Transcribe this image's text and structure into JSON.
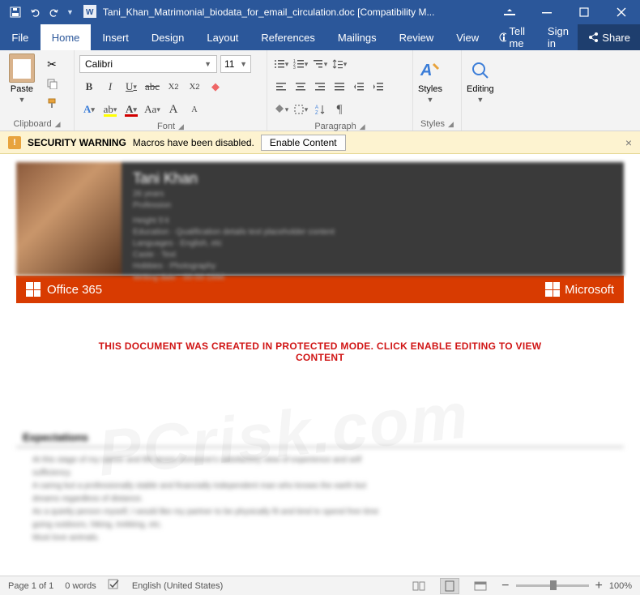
{
  "titlebar": {
    "filename": "Tani_Khan_Matrimonial_biodata_for_email_circulation.doc [Compatibility M..."
  },
  "menubar": {
    "file": "File",
    "tabs": [
      "Home",
      "Insert",
      "Design",
      "Layout",
      "References",
      "Mailings",
      "Review",
      "View"
    ],
    "tell": "Tell me",
    "signin": "Sign in",
    "share": "Share"
  },
  "ribbon": {
    "clipboard": {
      "paste": "Paste",
      "label": "Clipboard"
    },
    "font": {
      "name": "Calibri",
      "size": "11",
      "label": "Font"
    },
    "paragraph": {
      "label": "Paragraph"
    },
    "styles": {
      "btn": "Styles",
      "label": "Styles"
    },
    "editing": {
      "btn": "Editing"
    }
  },
  "warning": {
    "title": "SECURITY WARNING",
    "msg": "Macros have been disabled.",
    "enable": "Enable Content"
  },
  "document": {
    "biodata_name": "Tani Khan",
    "office_brand": "Office 365",
    "ms_brand": "Microsoft",
    "protected_line1": "THIS DOCUMENT WAS CREATED IN PROTECTED MODE. CLICK ENABLE EDITING TO VIEW",
    "protected_line2": "CONTENT",
    "expectations_head": "Expectations"
  },
  "statusbar": {
    "page": "Page 1 of 1",
    "words": "0 words",
    "lang": "English (United States)",
    "zoom": "100%"
  },
  "watermark": "PCrisk.com"
}
